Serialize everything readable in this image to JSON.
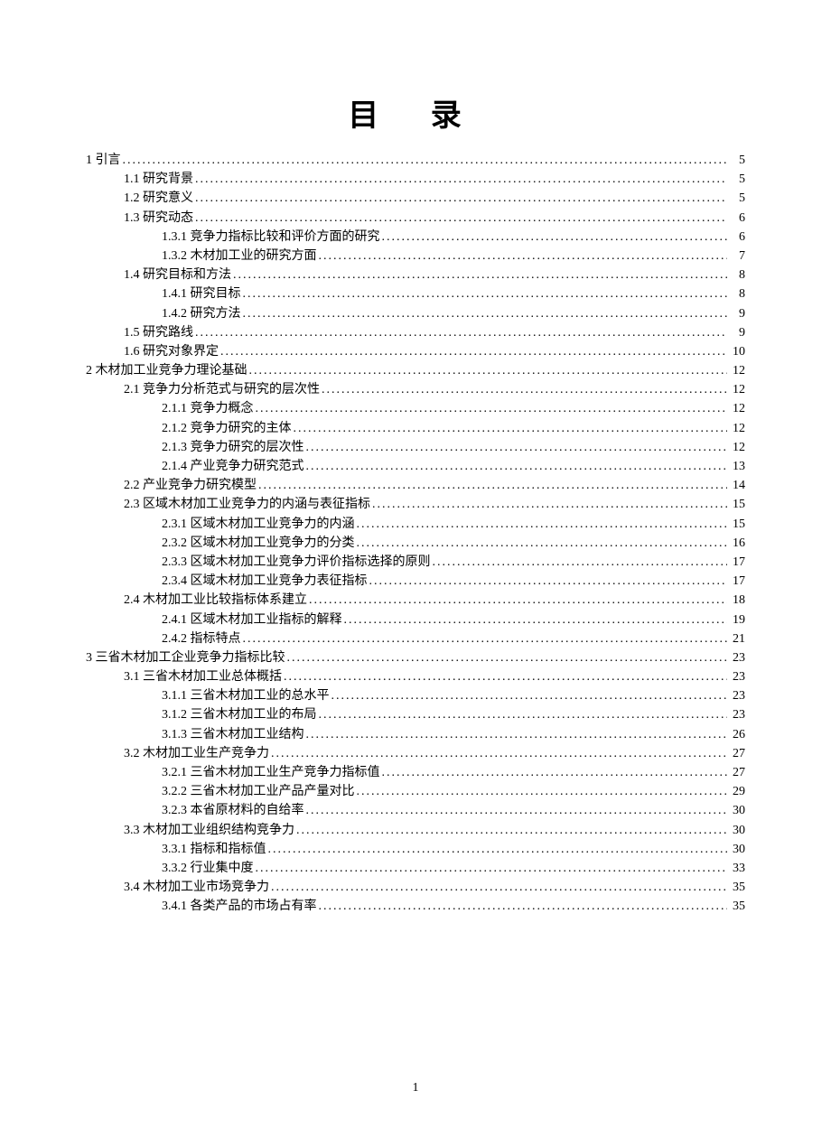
{
  "title": "目   录",
  "page_number": "1",
  "toc": [
    {
      "level": 0,
      "label": "1 引言",
      "page": "5"
    },
    {
      "level": 1,
      "label": "1.1 研究背景",
      "page": "5"
    },
    {
      "level": 1,
      "label": "1.2 研究意义",
      "page": "5"
    },
    {
      "level": 1,
      "label": "1.3 研究动态",
      "page": "6"
    },
    {
      "level": 2,
      "label": "1.3.1 竞争力指标比较和评价方面的研究",
      "page": "6"
    },
    {
      "level": 2,
      "label": "1.3.2 木材加工业的研究方面",
      "page": "7"
    },
    {
      "level": 1,
      "label": "1.4 研究目标和方法",
      "page": "8"
    },
    {
      "level": 2,
      "label": "1.4.1 研究目标",
      "page": "8"
    },
    {
      "level": 2,
      "label": "1.4.2 研究方法",
      "page": "9"
    },
    {
      "level": 1,
      "label": "1.5 研究路线",
      "page": "9"
    },
    {
      "level": 1,
      "label": "1.6 研究对象界定",
      "page": "10"
    },
    {
      "level": 0,
      "label": "2 木材加工业竞争力理论基础",
      "page": "12"
    },
    {
      "level": 1,
      "label": "2.1 竞争力分析范式与研究的层次性",
      "page": "12"
    },
    {
      "level": 2,
      "label": "2.1.1 竞争力概念",
      "page": "12"
    },
    {
      "level": 2,
      "label": "2.1.2 竞争力研究的主体",
      "page": "12"
    },
    {
      "level": 2,
      "label": "2.1.3 竞争力研究的层次性",
      "page": "12"
    },
    {
      "level": 2,
      "label": "2.1.4 产业竞争力研究范式",
      "page": "13"
    },
    {
      "level": 1,
      "label": "2.2 产业竞争力研究模型",
      "page": "14"
    },
    {
      "level": 1,
      "label": "2.3 区域木材加工业竞争力的内涵与表征指标",
      "page": "15"
    },
    {
      "level": 2,
      "label": "2.3.1 区域木材加工业竞争力的内涵",
      "page": "15"
    },
    {
      "level": 2,
      "label": "2.3.2 区域木材加工业竞争力的分类",
      "page": "16"
    },
    {
      "level": 2,
      "label": "2.3.3 区域木材加工业竞争力评价指标选择的原则",
      "page": "17"
    },
    {
      "level": 2,
      "label": "2.3.4 区域木材加工业竞争力表征指标",
      "page": "17"
    },
    {
      "level": 1,
      "label": "2.4 木材加工业比较指标体系建立",
      "page": "18"
    },
    {
      "level": 2,
      "label": "2.4.1 区域木材加工业指标的解释",
      "page": "19"
    },
    {
      "level": 2,
      "label": "2.4.2 指标特点",
      "page": "21"
    },
    {
      "level": 0,
      "label": "3 三省木材加工企业竞争力指标比较",
      "page": "23"
    },
    {
      "level": 1,
      "label": "3.1 三省木材加工业总体概括",
      "page": "23"
    },
    {
      "level": 2,
      "label": "3.1.1 三省木材加工业的总水平",
      "page": "23"
    },
    {
      "level": 2,
      "label": "3.1.2 三省木材加工业的布局",
      "page": "23"
    },
    {
      "level": 2,
      "label": "3.1.3 三省木材加工业结构",
      "page": "26"
    },
    {
      "level": 1,
      "label": "3.2 木材加工业生产竞争力",
      "page": "27"
    },
    {
      "level": 2,
      "label": "3.2.1 三省木材加工业生产竞争力指标值",
      "page": "27"
    },
    {
      "level": 2,
      "label": "3.2.2 三省木材加工业产品产量对比",
      "page": "29"
    },
    {
      "level": 2,
      "label": "3.2.3 本省原材料的自给率",
      "page": "30"
    },
    {
      "level": 1,
      "label": "3.3 木材加工业组织结构竞争力",
      "page": "30"
    },
    {
      "level": 2,
      "label": "3.3.1 指标和指标值",
      "page": "30"
    },
    {
      "level": 2,
      "label": "3.3.2 行业集中度",
      "page": "33"
    },
    {
      "level": 1,
      "label": "3.4 木材加工业市场竞争力",
      "page": "35"
    },
    {
      "level": 2,
      "label": "3.4.1 各类产品的市场占有率",
      "page": "35"
    }
  ]
}
